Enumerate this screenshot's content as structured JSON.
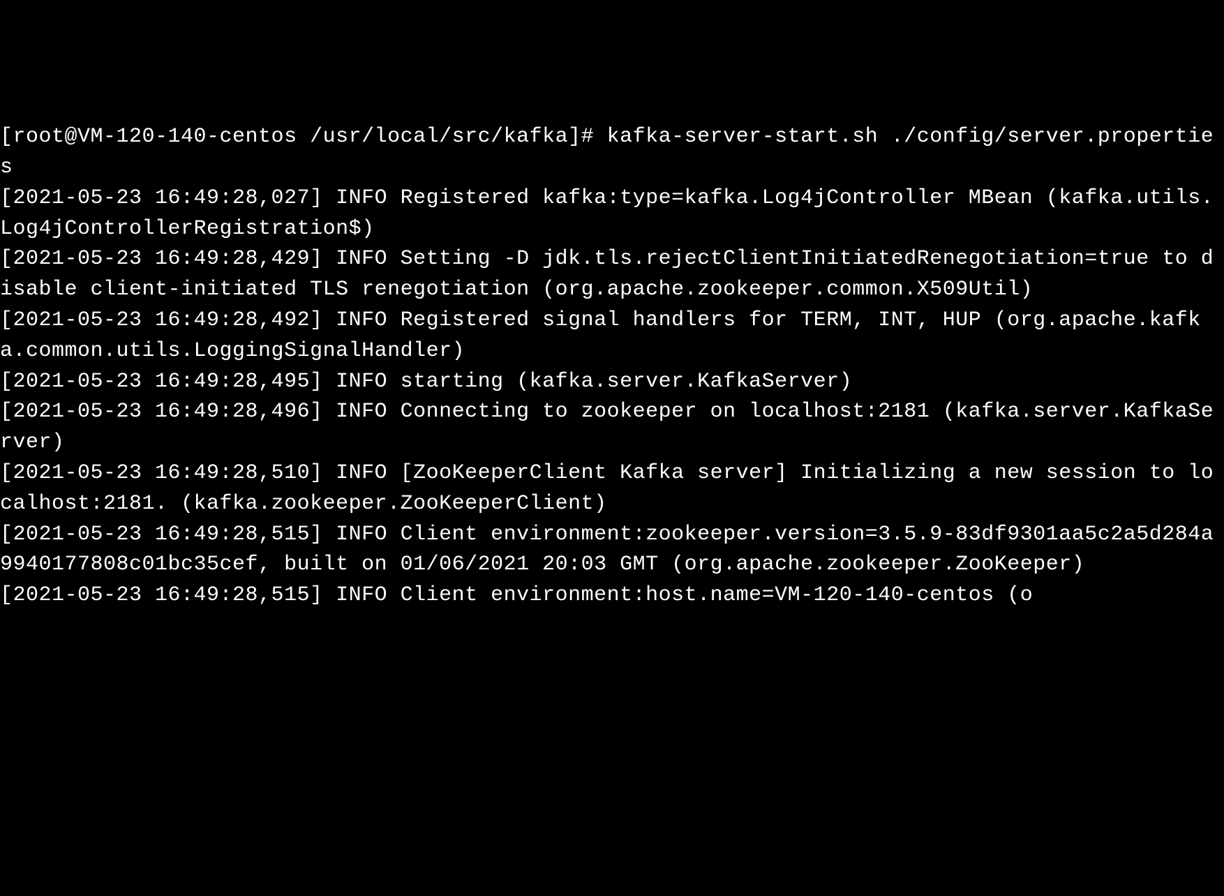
{
  "terminal": {
    "prompt": "[root@VM-120-140-centos /usr/local/src/kafka]# ",
    "command": "kafka-server-start.sh ./config/server.properties",
    "logs": [
      "[2021-05-23 16:49:28,027] INFO Registered kafka:type=kafka.Log4jController MBean (kafka.utils.Log4jControllerRegistration$)",
      "[2021-05-23 16:49:28,429] INFO Setting -D jdk.tls.rejectClientInitiatedRenegotiation=true to disable client-initiated TLS renegotiation (org.apache.zookeeper.common.X509Util)",
      "[2021-05-23 16:49:28,492] INFO Registered signal handlers for TERM, INT, HUP (org.apache.kafka.common.utils.LoggingSignalHandler)",
      "[2021-05-23 16:49:28,495] INFO starting (kafka.server.KafkaServer)",
      "[2021-05-23 16:49:28,496] INFO Connecting to zookeeper on localhost:2181 (kafka.server.KafkaServer)",
      "[2021-05-23 16:49:28,510] INFO [ZooKeeperClient Kafka server] Initializing a new session to localhost:2181. (kafka.zookeeper.ZooKeeperClient)",
      "[2021-05-23 16:49:28,515] INFO Client environment:zookeeper.version=3.5.9-83df9301aa5c2a5d284a9940177808c01bc35cef, built on 01/06/2021 20:03 GMT (org.apache.zookeeper.ZooKeeper)",
      "[2021-05-23 16:49:28,515] INFO Client environment:host.name=VM-120-140-centos (o"
    ]
  }
}
